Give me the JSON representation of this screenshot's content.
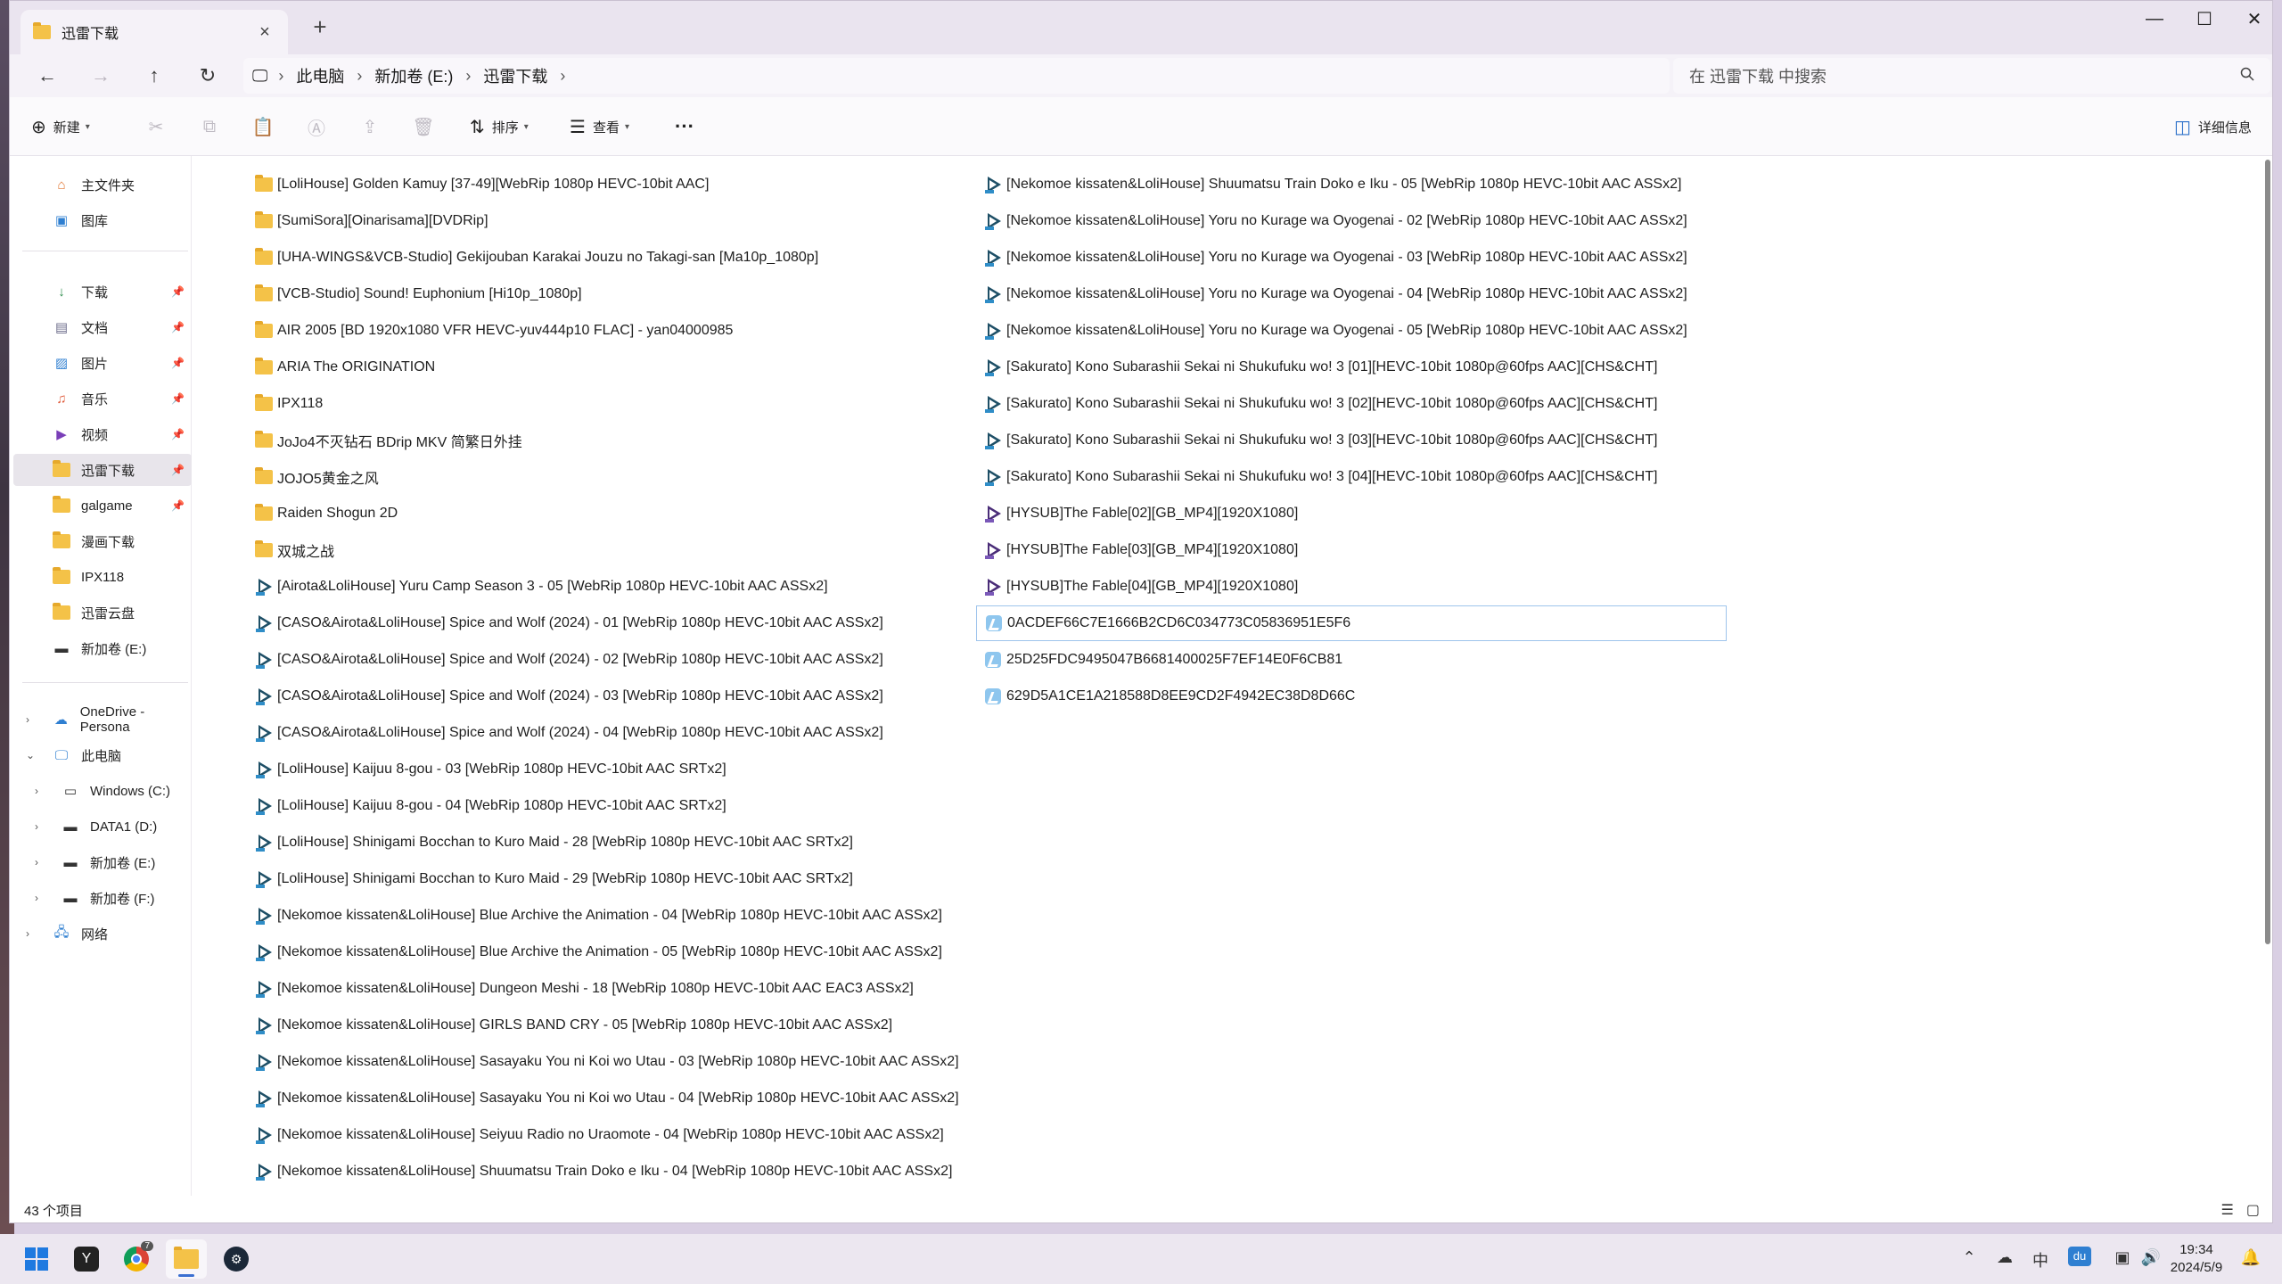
{
  "window": {
    "tab_title": "迅雷下载",
    "tab_close": "×",
    "new_tab": "+"
  },
  "window_controls": {
    "minimize": "—",
    "maximize": "☐",
    "close": "✕"
  },
  "address": {
    "breadcrumb": [
      "此电脑",
      "新加卷 (E:)",
      "迅雷下载"
    ],
    "search_placeholder": "在 迅雷下载 中搜索"
  },
  "toolbar": {
    "new_label": "新建",
    "sort_label": "排序",
    "view_label": "查看",
    "more_label": "···",
    "details_label": "详细信息"
  },
  "sidebar": {
    "home": "主文件夹",
    "gallery": "图库",
    "quick_access": [
      {
        "label": "下载",
        "icon": "download-icon"
      },
      {
        "label": "文档",
        "icon": "document-icon"
      },
      {
        "label": "图片",
        "icon": "picture-icon"
      },
      {
        "label": "音乐",
        "icon": "music-icon"
      },
      {
        "label": "视频",
        "icon": "video-icon"
      },
      {
        "label": "迅雷下载",
        "icon": "folder-icon"
      },
      {
        "label": "galgame",
        "icon": "folder-icon"
      },
      {
        "label": "漫画下载",
        "icon": "folder-icon"
      },
      {
        "label": "IPX118",
        "icon": "folder-icon"
      },
      {
        "label": "迅雷云盘",
        "icon": "folder-icon"
      },
      {
        "label": "新加卷 (E:)",
        "icon": "drive-icon"
      }
    ],
    "onedrive": "OneDrive - Persona",
    "this_pc": "此电脑",
    "drives": [
      "Windows (C:)",
      "DATA1 (D:)",
      "新加卷 (E:)",
      "新加卷 (F:)"
    ],
    "network": "网络"
  },
  "files_col1": [
    {
      "name": "[LoliHouse] Golden Kamuy [37-49][WebRip 1080p HEVC-10bit AAC]",
      "type": "folder"
    },
    {
      "name": "[SumiSora][Oinarisama][DVDRip]",
      "type": "folder"
    },
    {
      "name": "[UHA-WINGS&VCB-Studio] Gekijouban Karakai Jouzu no Takagi-san [Ma10p_1080p]",
      "type": "folder"
    },
    {
      "name": "[VCB-Studio] Sound! Euphonium [Hi10p_1080p]",
      "type": "folder"
    },
    {
      "name": "AIR 2005 [BD 1920x1080 VFR HEVC-yuv444p10 FLAC] - yan04000985",
      "type": "folder"
    },
    {
      "name": "ARIA The ORIGINATION",
      "type": "folder"
    },
    {
      "name": "IPX118",
      "type": "folder"
    },
    {
      "name": "JoJo4不灭钻石 BDrip MKV 简繁日外挂",
      "type": "folder"
    },
    {
      "name": "JOJO5黄金之风",
      "type": "folder"
    },
    {
      "name": "Raiden Shogun 2D",
      "type": "folder"
    },
    {
      "name": "双城之战",
      "type": "folder"
    },
    {
      "name": "[Airota&LoliHouse] Yuru Camp Season 3 - 05 [WebRip 1080p HEVC-10bit AAC ASSx2]",
      "type": "video"
    },
    {
      "name": "[CASO&Airota&LoliHouse] Spice and Wolf (2024) - 01 [WebRip 1080p HEVC-10bit AAC ASSx2]",
      "type": "video"
    },
    {
      "name": "[CASO&Airota&LoliHouse] Spice and Wolf (2024) - 02 [WebRip 1080p HEVC-10bit AAC ASSx2]",
      "type": "video"
    },
    {
      "name": "[CASO&Airota&LoliHouse] Spice and Wolf (2024) - 03 [WebRip 1080p HEVC-10bit AAC ASSx2]",
      "type": "video"
    },
    {
      "name": "[CASO&Airota&LoliHouse] Spice and Wolf (2024) - 04 [WebRip 1080p HEVC-10bit AAC ASSx2]",
      "type": "video"
    },
    {
      "name": "[LoliHouse] Kaijuu 8-gou - 03 [WebRip 1080p HEVC-10bit AAC SRTx2]",
      "type": "video"
    },
    {
      "name": "[LoliHouse] Kaijuu 8-gou - 04 [WebRip 1080p HEVC-10bit AAC SRTx2]",
      "type": "video"
    },
    {
      "name": "[LoliHouse] Shinigami Bocchan to Kuro Maid - 28 [WebRip 1080p HEVC-10bit AAC SRTx2]",
      "type": "video"
    },
    {
      "name": "[LoliHouse] Shinigami Bocchan to Kuro Maid - 29 [WebRip 1080p HEVC-10bit AAC SRTx2]",
      "type": "video"
    },
    {
      "name": "[Nekomoe kissaten&LoliHouse] Blue Archive the Animation - 04 [WebRip 1080p HEVC-10bit AAC ASSx2]",
      "type": "video"
    },
    {
      "name": "[Nekomoe kissaten&LoliHouse] Blue Archive the Animation - 05 [WebRip 1080p HEVC-10bit AAC ASSx2]",
      "type": "video"
    },
    {
      "name": "[Nekomoe kissaten&LoliHouse] Dungeon Meshi - 18 [WebRip 1080p HEVC-10bit AAC EAC3 ASSx2]",
      "type": "video"
    },
    {
      "name": "[Nekomoe kissaten&LoliHouse] GIRLS BAND CRY - 05 [WebRip 1080p HEVC-10bit AAC ASSx2]",
      "type": "video"
    },
    {
      "name": "[Nekomoe kissaten&LoliHouse] Sasayaku You ni Koi wo Utau - 03 [WebRip 1080p HEVC-10bit AAC ASSx2]",
      "type": "video"
    },
    {
      "name": "[Nekomoe kissaten&LoliHouse] Sasayaku You ni Koi wo Utau - 04 [WebRip 1080p HEVC-10bit AAC ASSx2]",
      "type": "video"
    },
    {
      "name": "[Nekomoe kissaten&LoliHouse] Seiyuu Radio no Uraomote - 04 [WebRip 1080p HEVC-10bit AAC ASSx2]",
      "type": "video"
    },
    {
      "name": "[Nekomoe kissaten&LoliHouse] Shuumatsu Train Doko e Iku - 04 [WebRip 1080p HEVC-10bit AAC ASSx2]",
      "type": "video"
    }
  ],
  "files_col2": [
    {
      "name": "[Nekomoe kissaten&LoliHouse] Shuumatsu Train Doko e Iku - 05 [WebRip 1080p HEVC-10bit AAC ASSx2]",
      "type": "video"
    },
    {
      "name": "[Nekomoe kissaten&LoliHouse] Yoru no Kurage wa Oyogenai - 02 [WebRip 1080p HEVC-10bit AAC ASSx2]",
      "type": "video"
    },
    {
      "name": "[Nekomoe kissaten&LoliHouse] Yoru no Kurage wa Oyogenai - 03 [WebRip 1080p HEVC-10bit AAC ASSx2]",
      "type": "video"
    },
    {
      "name": "[Nekomoe kissaten&LoliHouse] Yoru no Kurage wa Oyogenai - 04 [WebRip 1080p HEVC-10bit AAC ASSx2]",
      "type": "video"
    },
    {
      "name": "[Nekomoe kissaten&LoliHouse] Yoru no Kurage wa Oyogenai - 05 [WebRip 1080p HEVC-10bit AAC ASSx2]",
      "type": "video"
    },
    {
      "name": "[Sakurato] Kono Subarashii Sekai ni Shukufuku wo! 3 [01][HEVC-10bit 1080p@60fps AAC][CHS&CHT]",
      "type": "video"
    },
    {
      "name": "[Sakurato] Kono Subarashii Sekai ni Shukufuku wo! 3 [02][HEVC-10bit 1080p@60fps AAC][CHS&CHT]",
      "type": "video"
    },
    {
      "name": "[Sakurato] Kono Subarashii Sekai ni Shukufuku wo! 3 [03][HEVC-10bit 1080p@60fps AAC][CHS&CHT]",
      "type": "video"
    },
    {
      "name": "[Sakurato] Kono Subarashii Sekai ni Shukufuku wo! 3 [04][HEVC-10bit 1080p@60fps AAC][CHS&CHT]",
      "type": "video"
    },
    {
      "name": "[HYSUB]The Fable[02][GB_MP4][1920X1080]",
      "type": "video-purple"
    },
    {
      "name": "[HYSUB]The Fable[03][GB_MP4][1920X1080]",
      "type": "video-purple"
    },
    {
      "name": "[HYSUB]The Fable[04][GB_MP4][1920X1080]",
      "type": "video-purple"
    },
    {
      "name": "0ACDEF66C7E1666B2CD6C034773C05836951E5F6",
      "type": "thunder",
      "selected": true
    },
    {
      "name": "25D25FDC9495047B6681400025F7EF14E0F6CB81",
      "type": "thunder"
    },
    {
      "name": "629D5A1CE1A218588D8EE9CD2F4942EC38D8D66C",
      "type": "thunder"
    }
  ],
  "status": {
    "item_count": "43 个项目"
  },
  "taskbar": {
    "time": "19:34",
    "date": "2024/5/9",
    "chrome_badge": "7",
    "tray_ime": "中",
    "tray_baidu": "du"
  },
  "colors": {
    "folder": "#f4c248",
    "selection_border": "#9ec4ec",
    "accent": "#3b6fd1"
  }
}
